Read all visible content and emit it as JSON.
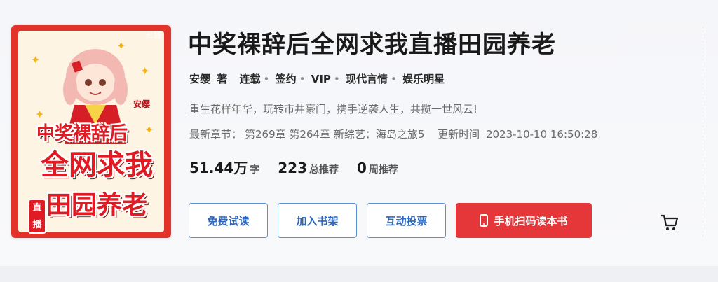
{
  "cover": {
    "watermark": "七猫",
    "author_stamp": "安缨",
    "title_line1": "中奖裸辞后",
    "title_line2": "全网求我",
    "title_line3": "田园养老",
    "side_tag": "直播"
  },
  "book": {
    "title": "中奖裸辞后全网求我直播田园养老",
    "author": "安缨",
    "author_suffix": "著",
    "status": "连载",
    "contract": "签约",
    "vip": "VIP",
    "category": "现代言情",
    "subcategory": "娱乐明星",
    "intro": "重生花样年华，玩转市井豪门，携手逆袭人生，共揽一世风云!",
    "latest_label": "最新章节：",
    "latest_chapter": "第269章 第264章 新综艺：海岛之旅5",
    "update_label": "更新时间",
    "update_time": "2023-10-10 16:50:28"
  },
  "stats": {
    "words_value": "51.44万",
    "words_unit": "字",
    "recommend_value": "223",
    "recommend_unit": "总推荐",
    "weekly_value": "0",
    "weekly_unit": "周推荐"
  },
  "actions": {
    "free_read": "免费试读",
    "add_shelf": "加入书架",
    "vote": "互动投票",
    "mobile_read": "手机扫码读本书"
  },
  "icons": {
    "phone": "phone-icon",
    "cart": "cart-icon"
  },
  "colors": {
    "primary_button": "#e5363a",
    "outline_button": "#2b66c0",
    "cover_red": "#e2322a"
  }
}
